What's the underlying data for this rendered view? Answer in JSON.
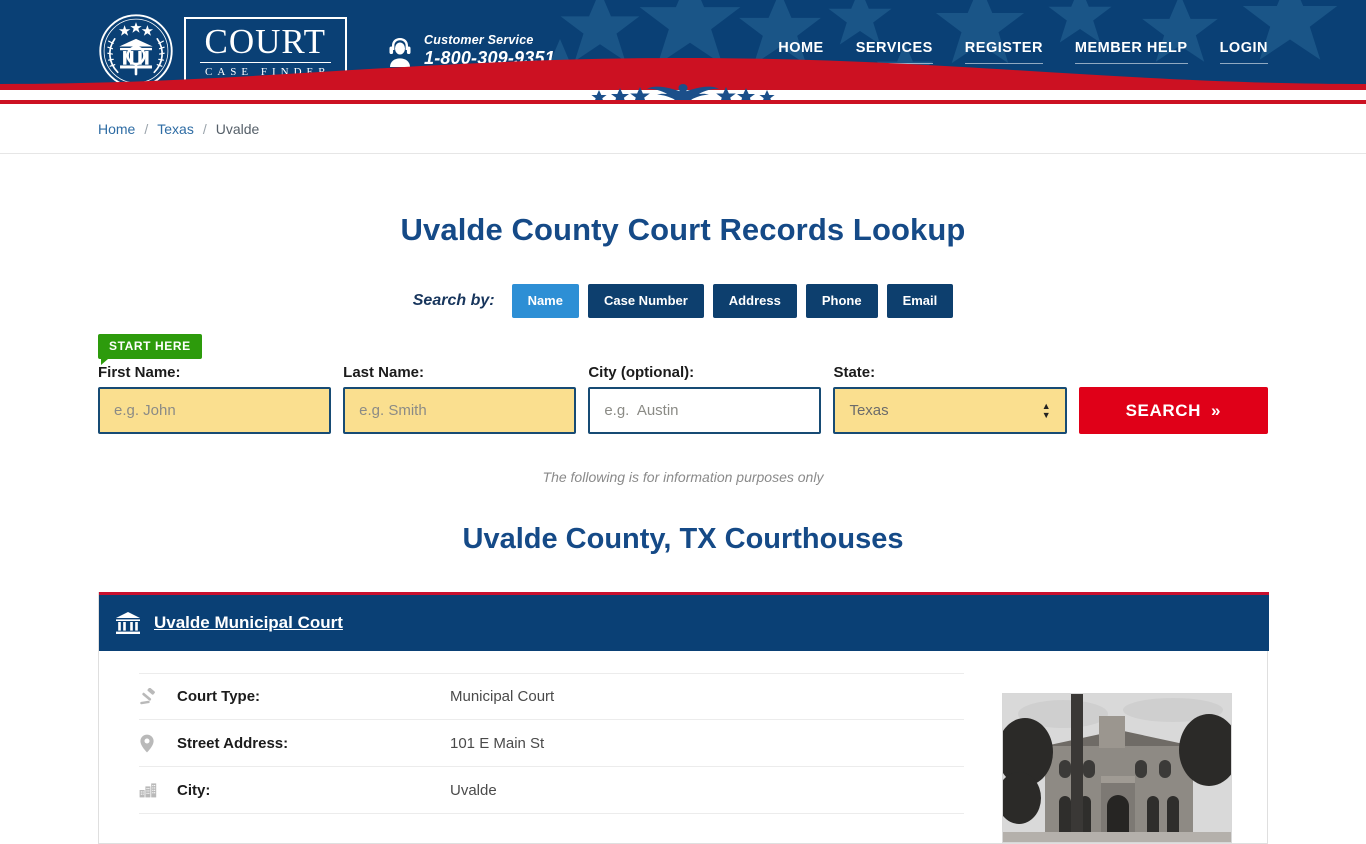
{
  "header": {
    "logo": {
      "main": "COURT",
      "sub": "CASE FINDER",
      "seal_icon": "court-seal-icon"
    },
    "customer_service": {
      "label": "Customer Service",
      "phone": "1-800-309-9351",
      "icon": "headset-support-icon"
    },
    "nav": [
      {
        "label": "HOME"
      },
      {
        "label": "SERVICES"
      },
      {
        "label": "REGISTER"
      },
      {
        "label": "MEMBER HELP"
      },
      {
        "label": "LOGIN"
      }
    ],
    "colors": {
      "navy": "#0a4075",
      "red": "#cc1122",
      "white": "#ffffff"
    }
  },
  "breadcrumb": {
    "items": [
      {
        "label": "Home",
        "link": true
      },
      {
        "label": "Texas",
        "link": true
      },
      {
        "label": "Uvalde",
        "link": false
      }
    ],
    "separator": "/"
  },
  "main": {
    "page_title": "Uvalde County Court Records Lookup",
    "search_by": {
      "label": "Search by:",
      "tabs": [
        {
          "label": "Name",
          "active": true
        },
        {
          "label": "Case Number",
          "active": false
        },
        {
          "label": "Address",
          "active": false
        },
        {
          "label": "Phone",
          "active": false
        },
        {
          "label": "Email",
          "active": false
        }
      ],
      "active_color": "#2d8fd5",
      "inactive_color": "#0d3f6e"
    },
    "start_here_badge": "START HERE",
    "form": {
      "first_name": {
        "label": "First Name:",
        "placeholder": "e.g. John",
        "value": ""
      },
      "last_name": {
        "label": "Last Name:",
        "placeholder": "e.g. Smith",
        "value": ""
      },
      "city": {
        "label": "City (optional):",
        "placeholder": "e.g.  Austin",
        "value": ""
      },
      "state": {
        "label": "State:",
        "value": "Texas"
      },
      "search_button": "SEARCH",
      "search_button_chevron": "»",
      "field_bg": "#fadf8f",
      "button_bg": "#e00018"
    },
    "info_note": "The following is for information purposes only",
    "section_title": "Uvalde County, TX Courthouses"
  },
  "court_card": {
    "title": "Uvalde Municipal Court",
    "title_icon": "bank-building-icon",
    "rows": [
      {
        "icon": "gavel-icon",
        "label": "Court Type:",
        "value": "Municipal Court"
      },
      {
        "icon": "map-pin-icon",
        "label": "Street Address:",
        "value": "101 E Main St"
      },
      {
        "icon": "city-buildings-icon",
        "label": "City:",
        "value": "Uvalde"
      }
    ],
    "photo_alt": "courthouse-photo"
  }
}
